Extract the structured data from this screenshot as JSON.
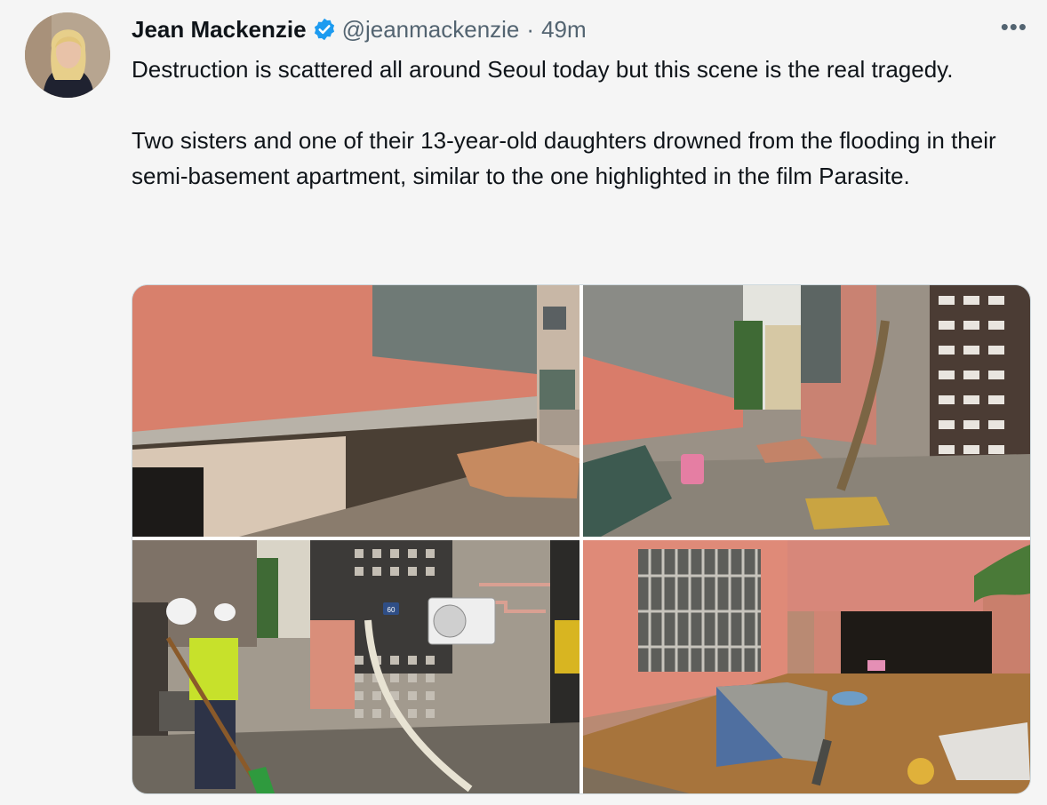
{
  "tweet": {
    "author_name": "Jean Mackenzie",
    "handle": "@jeanmackenzie",
    "separator": "·",
    "time": "49m",
    "more_label": "•••",
    "paragraphs": [
      "Destruction is scattered all around Seoul today but this scene is the real tragedy.",
      "Two sisters and one of their 13-year-old daughters drowned from the flooding in their semi-basement apartment, similar to the one highlighted in the film Parasite."
    ],
    "photo_count": 4,
    "sign_number": "60"
  },
  "colors": {
    "verified": "#1d9bf0",
    "text": "#0f1419",
    "muted": "#536471",
    "wall_pink": "#d97e6c",
    "flood_water": "#a7743c"
  }
}
